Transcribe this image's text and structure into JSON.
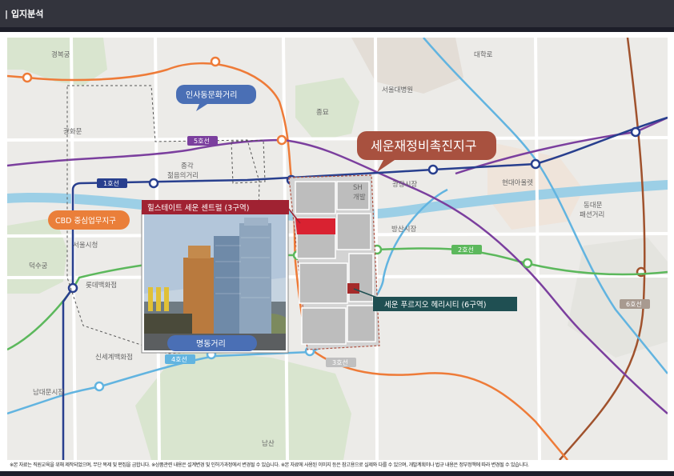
{
  "header": {
    "title": "| 입지분석"
  },
  "map": {
    "place_labels": {
      "gyeongbokgung": "경복궁",
      "gwanghwamun": "광화문",
      "seoul_city_hall": "서울시청",
      "deoksugung": "덕수궁",
      "lotte_dept": "롯데백화점",
      "shinsegae": "신세계백화점",
      "namdaemun": "남대문시장",
      "namsan": "남산",
      "daehakro": "대학로",
      "snu_hospital": "서울대병원",
      "jongmyo": "종묘",
      "gwangjang": "광장시장",
      "hyundai_city_outlet": "현대아울렛",
      "dongdaemun": "동대문\n패션거리",
      "bangsan": "방산시장",
      "jonggak": "종각\n젊음의거리",
      "sh": "SH\n개발"
    },
    "callouts": {
      "insadong": "인사동문화거리",
      "cbd": "CBD 중심업무지구",
      "myeongdong": "명동거리",
      "sewoon_district": "세운재정비촉진지구",
      "hillstate": "힐스테이트 세운 센트럴 (3구역)",
      "prugio": "세운 푸르지오 헤리시티 (6구역)"
    },
    "line_labels": {
      "line1": "1호선",
      "line2": "2호선",
      "line3": "3호선",
      "line4": "4호선",
      "line5": "5호선",
      "line6": "6호선"
    },
    "line_colors": {
      "line1": "#283f8e",
      "line2": "#5cb85c",
      "line3": "#ee7b38",
      "line4": "#62b4e0",
      "line5": "#7b3f9e",
      "line6": "#a0522d",
      "highlight_red": "#d92231",
      "callout_brown": "#a8513f",
      "callout_teal": "#1f4f52",
      "callout_blue": "#4a6fb5",
      "callout_orange": "#ea7f3a"
    }
  },
  "footer": {
    "disclaimer": "※본 자료는 직원교육을 위해 제작되었으며, 무단 복제 및 편집을 금합니다.  ※상품관련 내용은 설계변경 및 인허가과정에서 변경될 수 있습니다.  ※본 자료에 사용된 이미지 등은 참고용으로 실제와 다를 수 있으며, 개발계획이나 법규 내용은 정부정책에 따라 변경될 수 있습니다."
  }
}
